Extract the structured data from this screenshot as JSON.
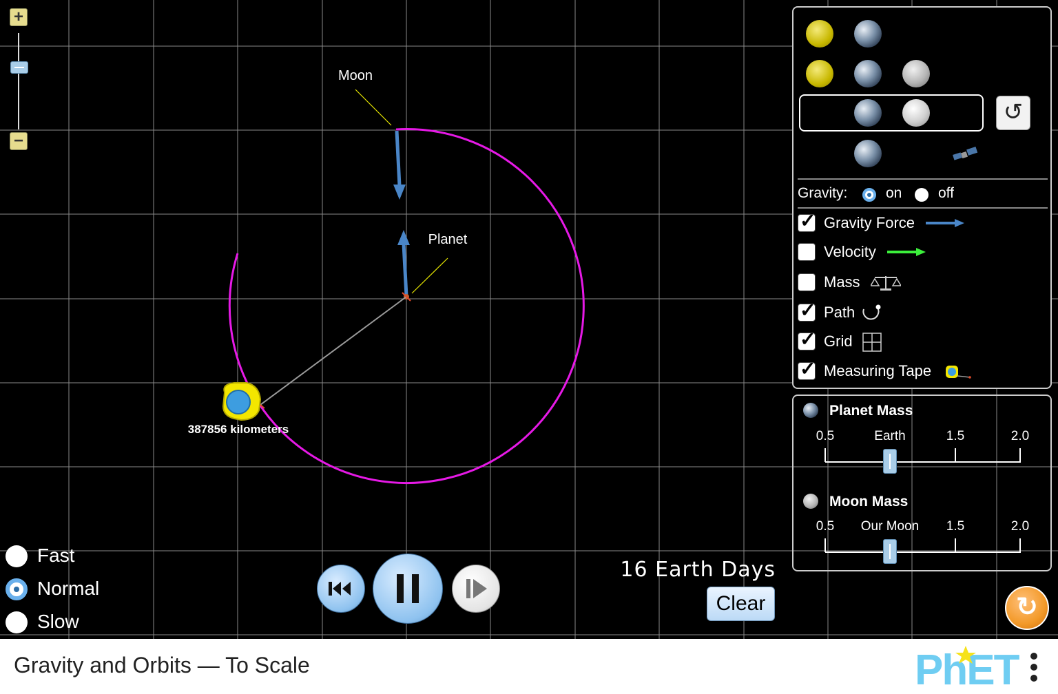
{
  "sim_title": "Gravity and Orbits — To Scale",
  "scene": {
    "moon_label": "Moon",
    "planet_label": "Planet",
    "measuring_tape_readout": "387856 kilometers",
    "path_color": "#e619e6",
    "force_arrow_color": "#4a86c8",
    "grid_color": "#8a8a8a"
  },
  "zoom": {
    "zoom_in_icon": "plus-icon",
    "zoom_out_icon": "minus-icon"
  },
  "controls": {
    "gravity_label": "Gravity:",
    "gravity_on_label": "on",
    "gravity_off_label": "off",
    "gravity_state": "on",
    "checkboxes": [
      {
        "label": "Gravity Force",
        "checked": true,
        "icon": "gravity-force-arrow-icon"
      },
      {
        "label": "Velocity",
        "checked": false,
        "icon": "velocity-arrow-icon"
      },
      {
        "label": "Mass",
        "checked": false,
        "icon": "balance-scale-icon"
      },
      {
        "label": "Path",
        "checked": true,
        "icon": "path-icon"
      },
      {
        "label": "Grid",
        "checked": true,
        "icon": "grid-icon"
      },
      {
        "label": "Measuring Tape",
        "checked": true,
        "icon": "measuring-tape-icon"
      }
    ]
  },
  "mass": {
    "planet_title": "Planet Mass",
    "planet_ticks": [
      "0.5",
      "Earth",
      "1.5",
      "2.0"
    ],
    "planet_value": 1.0,
    "moon_title": "Moon Mass",
    "moon_ticks": [
      "0.5",
      "Our Moon",
      "1.5",
      "2.0"
    ],
    "moon_value": 1.0
  },
  "speed": {
    "options": [
      "Fast",
      "Normal",
      "Slow"
    ],
    "selected": "Normal"
  },
  "elapsed_time": "16 Earth Days",
  "clear_label": "Clear",
  "brand": {
    "logo_text": "PhET",
    "accent": "#6fcdf2",
    "star_color": "#f6e21b"
  }
}
